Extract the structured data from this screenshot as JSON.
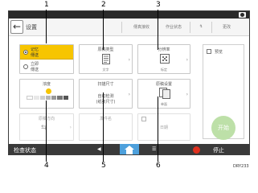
{
  "callouts": {
    "top": [
      "1",
      "2",
      "3"
    ],
    "bottom": [
      "4",
      "5",
      "6"
    ]
  },
  "header": {
    "title": "设置",
    "items": [
      "傳真接收",
      "作业状态",
      "↯",
      "更改"
    ]
  },
  "color_mode": {
    "option_selected": "记忆",
    "option_selected_sub": "傳送",
    "option_other": "立即",
    "option_other_sub": "傳送"
  },
  "tiles": {
    "doc_type": {
      "label": "原稿类型",
      "value": "文字"
    },
    "resolution": {
      "label": "分辨率",
      "value": "标定"
    },
    "density": {
      "label": "浓度"
    },
    "scan_size": {
      "label": "扫描尺寸",
      "value_line1": "自动检测",
      "value_line2": "(纸张尺寸)"
    },
    "orig_settings": {
      "label": "原稿设置",
      "value": "单面"
    },
    "bottom_left": {
      "label": "原稿方向"
    },
    "bottom_mid": {
      "label": "发件名"
    },
    "bottom_right": {
      "label": "日期"
    }
  },
  "preview": {
    "checkbox_label": "预览"
  },
  "start_label": "开始",
  "bottombar": {
    "check_status": "检查状态",
    "stop": "停止"
  },
  "figure_code": "DRY233",
  "colors": {
    "accent_yellow": "#f7c500",
    "start_green": "#bde0a8",
    "home_blue": "#4da0dc",
    "stop_red": "#e0301e"
  }
}
